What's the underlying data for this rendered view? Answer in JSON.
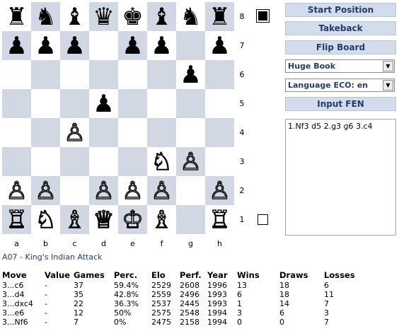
{
  "board": {
    "ranks": [
      "8",
      "7",
      "6",
      "5",
      "4",
      "3",
      "2",
      "1"
    ],
    "files": [
      "a",
      "b",
      "c",
      "d",
      "e",
      "f",
      "g",
      "h"
    ],
    "position": [
      [
        "bR",
        "bN",
        "bB",
        "bQ",
        "bK",
        "bB",
        "bN",
        "bR"
      ],
      [
        "bP",
        "bP",
        "bP",
        "",
        "bP",
        "bP",
        "",
        "bP"
      ],
      [
        "",
        "",
        "",
        "",
        "",
        "",
        "bP",
        ""
      ],
      [
        "",
        "",
        "",
        "bP",
        "",
        "",
        "",
        ""
      ],
      [
        "",
        "",
        "wP",
        "",
        "",
        "",
        "",
        ""
      ],
      [
        "",
        "",
        "",
        "",
        "",
        "wN",
        "wP",
        ""
      ],
      [
        "wP",
        "wP",
        "",
        "wP",
        "wP",
        "wP",
        "",
        "wP"
      ],
      [
        "wR",
        "wN",
        "wB",
        "wQ",
        "wK",
        "wB",
        "",
        "wR"
      ]
    ],
    "piece_glyphs": {
      "wK": "♔",
      "wQ": "♕",
      "wR": "♖",
      "wB": "♗",
      "wN": "♘",
      "wP": "♙",
      "bK": "♚",
      "bQ": "♛",
      "bR": "♜",
      "bB": "♝",
      "bN": "♞",
      "bP": "♟"
    },
    "colors": {
      "light": "#ffffff",
      "dark": "#d2d7e4"
    }
  },
  "controls": {
    "start_position": "Start Position",
    "takeback": "Takeback",
    "flip_board": "Flip Board",
    "book_select": "Huge Book",
    "language_select": "Language ECO: en",
    "input_fen": "Input FEN"
  },
  "game": {
    "pgn": "1.Nf3 d5 2.g3 g6 3.c4"
  },
  "opening": {
    "name": "A07 - King's Indian Attack"
  },
  "moves_table": {
    "headers": [
      "Move",
      "Value",
      "Games",
      "Perc.",
      "Elo",
      "Perf.",
      "Year",
      "Wins",
      "Draws",
      "Losses"
    ],
    "rows": [
      [
        "3...c6",
        "-",
        "37",
        "59.4%",
        "2529",
        "2608",
        "1996",
        "13",
        "18",
        "6"
      ],
      [
        "3...d4",
        "-",
        "35",
        "42.8%",
        "2559",
        "2496",
        "1993",
        "6",
        "18",
        "11"
      ],
      [
        "3...dxc4",
        "-",
        "22",
        "36.3%",
        "2537",
        "2445",
        "1993",
        "1",
        "14",
        "7"
      ],
      [
        "3...e6",
        "-",
        "12",
        "50%",
        "2575",
        "2548",
        "1994",
        "3",
        "6",
        "3"
      ],
      [
        "3...Nf6",
        "-",
        "7",
        "0%",
        "2475",
        "2158",
        "1994",
        "0",
        "0",
        "7"
      ]
    ]
  },
  "accent_color": "#243a6b"
}
